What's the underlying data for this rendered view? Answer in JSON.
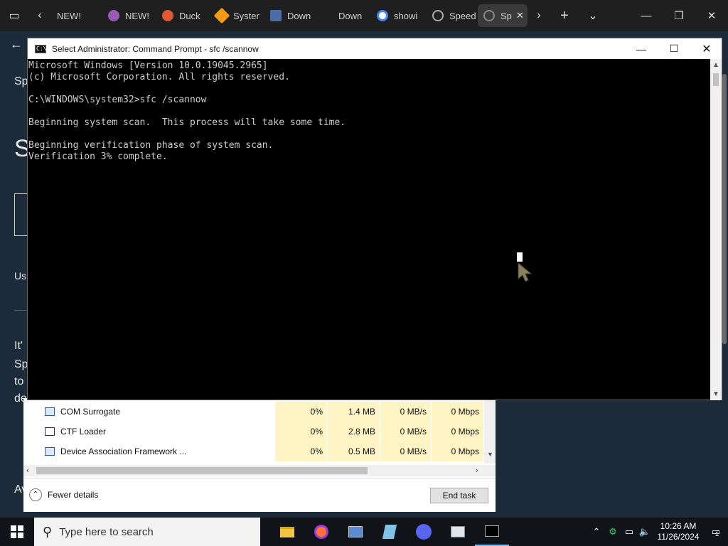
{
  "browser": {
    "tabs": [
      {
        "label": "NEW!",
        "color": "#ffffff"
      },
      {
        "label": "NEW!",
        "color": "#9b59b6"
      },
      {
        "label": "Duck",
        "color": "#de5833"
      },
      {
        "label": "Syster",
        "color": "#f39c12"
      },
      {
        "label": "Down",
        "color": "#4a6ea9"
      },
      {
        "label": "Down",
        "color": "#1f1f1f"
      },
      {
        "label": "showi",
        "color": "#4285f4"
      },
      {
        "label": "Speed",
        "color": "#aaaaaa"
      },
      {
        "label": "Sp",
        "color": "#666666"
      }
    ]
  },
  "background_page": {
    "fragments": [
      "Sp",
      "S",
      "Us",
      "It'",
      "Sp",
      "to",
      "de",
      "Av"
    ]
  },
  "cmd": {
    "title": "Select Administrator: Command Prompt - sfc  /scannow",
    "lines": [
      "Microsoft Windows [Version 10.0.19045.2965]",
      "(c) Microsoft Corporation. All rights reserved.",
      "",
      "C:\\WINDOWS\\system32>sfc /scannow",
      "",
      "Beginning system scan.  This process will take some time.",
      "",
      "Beginning verification phase of system scan.",
      "Verification 3% complete."
    ]
  },
  "task_manager": {
    "rows": [
      {
        "name": "COM Surrogate",
        "cpu": "0%",
        "memory": "1.4 MB",
        "disk": "0 MB/s",
        "network": "0 Mbps"
      },
      {
        "name": "CTF Loader",
        "cpu": "0%",
        "memory": "2.8 MB",
        "disk": "0 MB/s",
        "network": "0 Mbps"
      },
      {
        "name": "Device Association Framework ...",
        "cpu": "0%",
        "memory": "0.5 MB",
        "disk": "0 MB/s",
        "network": "0 Mbps"
      }
    ],
    "fewer_details": "Fewer details",
    "end_task": "End task"
  },
  "taskbar": {
    "search_placeholder": "Type here to search",
    "time": "10:26 AM",
    "date": "11/26/2024",
    "notification_count": "1"
  }
}
